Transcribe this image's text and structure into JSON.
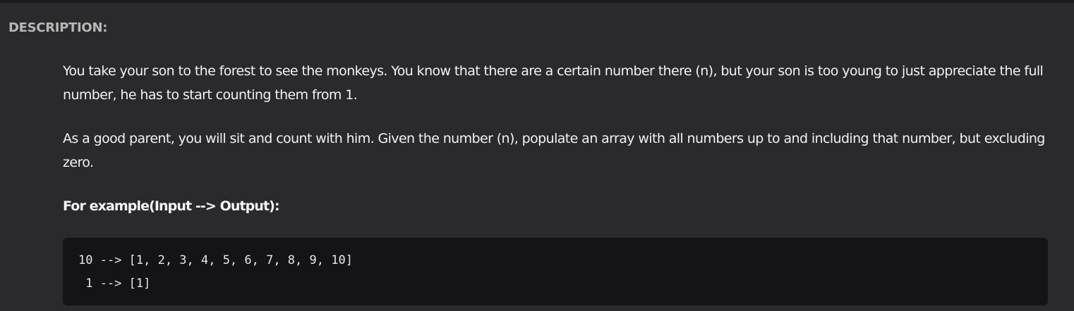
{
  "description": {
    "heading": "DESCRIPTION:",
    "paragraph_1": "You take your son to the forest to see the monkeys. You know that there are a certain number there (n), but your son is too young to just appreciate the full number, he has to start counting them from 1.",
    "paragraph_2": "As a good parent, you will sit and count with him. Given the number (n), populate an array with all numbers up to and including that number, but excluding zero.",
    "example_title": "For example(Input --> Output):",
    "code_lines": [
      "10 --> [1, 2, 3, 4, 5, 6, 7, 8, 9, 10]",
      " 1 --> [1]"
    ]
  },
  "colors": {
    "background": "#2a2a2d",
    "heading": "#b8b8b8",
    "text": "#f2f2f2",
    "code_background": "#141416"
  }
}
